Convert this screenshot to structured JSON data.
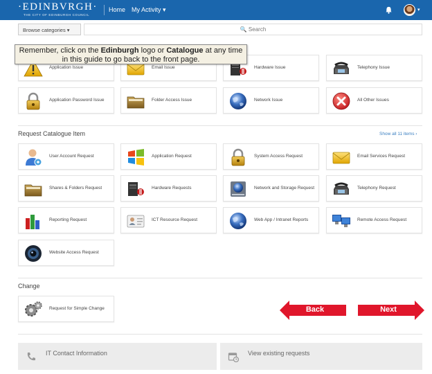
{
  "header": {
    "logo_main": "·EDINBVRGH·",
    "logo_sub": "THE CITY OF EDINBURGH COUNCIL",
    "nav_home": "Home",
    "nav_activity": "My Activity ▾",
    "avatar_caret": "▾"
  },
  "search": {
    "category_label": "Browse categories ▾",
    "placeholder": "🔍 Search"
  },
  "tooltip": {
    "text_1": "Remember, click on the ",
    "bold_1": "Edinburgh",
    "text_2": " logo or ",
    "bold_2": "Catalogue",
    "text_3": " at any time in this guide to go back to the front page."
  },
  "report_issue": {
    "row1": [
      {
        "label": "Application Issue",
        "icon": "warning-icon"
      },
      {
        "label": "Email Issue",
        "icon": "envelope-icon"
      },
      {
        "label": "Hardware Issue",
        "icon": "hardware-icon"
      },
      {
        "label": "Telephony Issue",
        "icon": "telephone-icon"
      }
    ],
    "row2": [
      {
        "label": "Application Password Issue",
        "icon": "padlock-icon"
      },
      {
        "label": "Folder Access Issue",
        "icon": "folder-icon"
      },
      {
        "label": "Network Issue",
        "icon": "globe-icon"
      },
      {
        "label": "All Other Issues",
        "icon": "error-x-icon"
      }
    ]
  },
  "request_catalogue": {
    "title": "Request Catalogue Item",
    "show_all": "Show all 11 items ›",
    "items": [
      {
        "label": "User Account Request",
        "icon": "user-icon"
      },
      {
        "label": "Application Request",
        "icon": "windows-icon"
      },
      {
        "label": "System Access Request",
        "icon": "padlock-icon"
      },
      {
        "label": "Email Services Request",
        "icon": "envelope-icon"
      },
      {
        "label": "Shares & Folders Request",
        "icon": "folder-icon"
      },
      {
        "label": "Hardware Requests",
        "icon": "hardware-icon"
      },
      {
        "label": "Network and Storage Request",
        "icon": "storage-icon"
      },
      {
        "label": "Telephony Request",
        "icon": "telephone-icon"
      },
      {
        "label": "Reporting Request",
        "icon": "bar-chart-icon"
      },
      {
        "label": "ICT Resource Request",
        "icon": "id-card-icon"
      },
      {
        "label": "Web App / Intranet Reports",
        "icon": "globe-icon"
      },
      {
        "label": "Remote Access Request",
        "icon": "monitors-icon"
      },
      {
        "label": "Website Access Request",
        "icon": "camera-icon"
      }
    ]
  },
  "change": {
    "title": "Change",
    "items": [
      {
        "label": "Request for Simple Change",
        "icon": "gears-icon"
      }
    ]
  },
  "navigation": {
    "back": "Back",
    "next": "Next",
    "back_color": "#e0162b",
    "next_color": "#e0162b"
  },
  "footer": {
    "contact": "IT Contact Information",
    "view_requests": "View existing requests"
  },
  "colors": {
    "header_bg": "#1a66ad",
    "link": "#3a7fc1"
  }
}
